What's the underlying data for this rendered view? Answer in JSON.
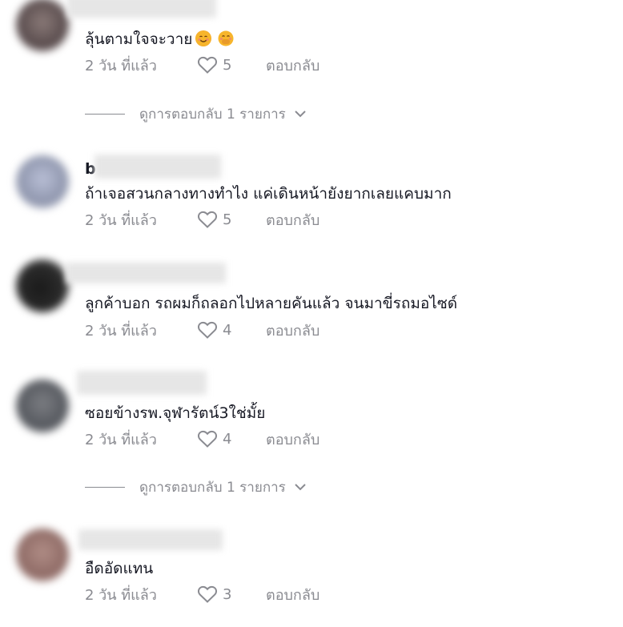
{
  "comments": [
    {
      "name_visible": "",
      "text": "ลุ้นตามใจจะวาย",
      "emojis": [
        "smiling-face-icon",
        "hand-over-mouth-icon"
      ],
      "time": "2 วัน ที่แล้ว",
      "likes": "5",
      "reply_label": "ตอบกลับ",
      "view_replies": "ดูการตอบกลับ 1 รายการ"
    },
    {
      "name_visible": "b",
      "text": "ถ้าเจอสวนกลางทางทำไง แค่เดินหน้ายังยากเลยแคบมาก",
      "time": "2 วัน ที่แล้ว",
      "likes": "5",
      "reply_label": "ตอบกลับ"
    },
    {
      "name_visible": "",
      "text": "ลูกค้าบอก รถผมก็ถลอกไปหลายคันแล้ว จนมาขี่รถมอไซด์",
      "time": "2 วัน ที่แล้ว",
      "likes": "4",
      "reply_label": "ตอบกลับ"
    },
    {
      "name_visible": "",
      "text": "ซอยข้างรพ.จุฬารัตน์3ใช่มั้ย",
      "time": "2 วัน ที่แล้ว",
      "likes": "4",
      "reply_label": "ตอบกลับ",
      "view_replies": "ดูการตอบกลับ 1 รายการ"
    },
    {
      "name_visible": "",
      "text": "อืดอัดแทน",
      "time": "2 วัน ที่แล้ว",
      "likes": "3",
      "reply_label": "ตอบกลับ"
    }
  ],
  "colors": {
    "text_primary": "#161823",
    "text_secondary": "#8a8b91"
  }
}
